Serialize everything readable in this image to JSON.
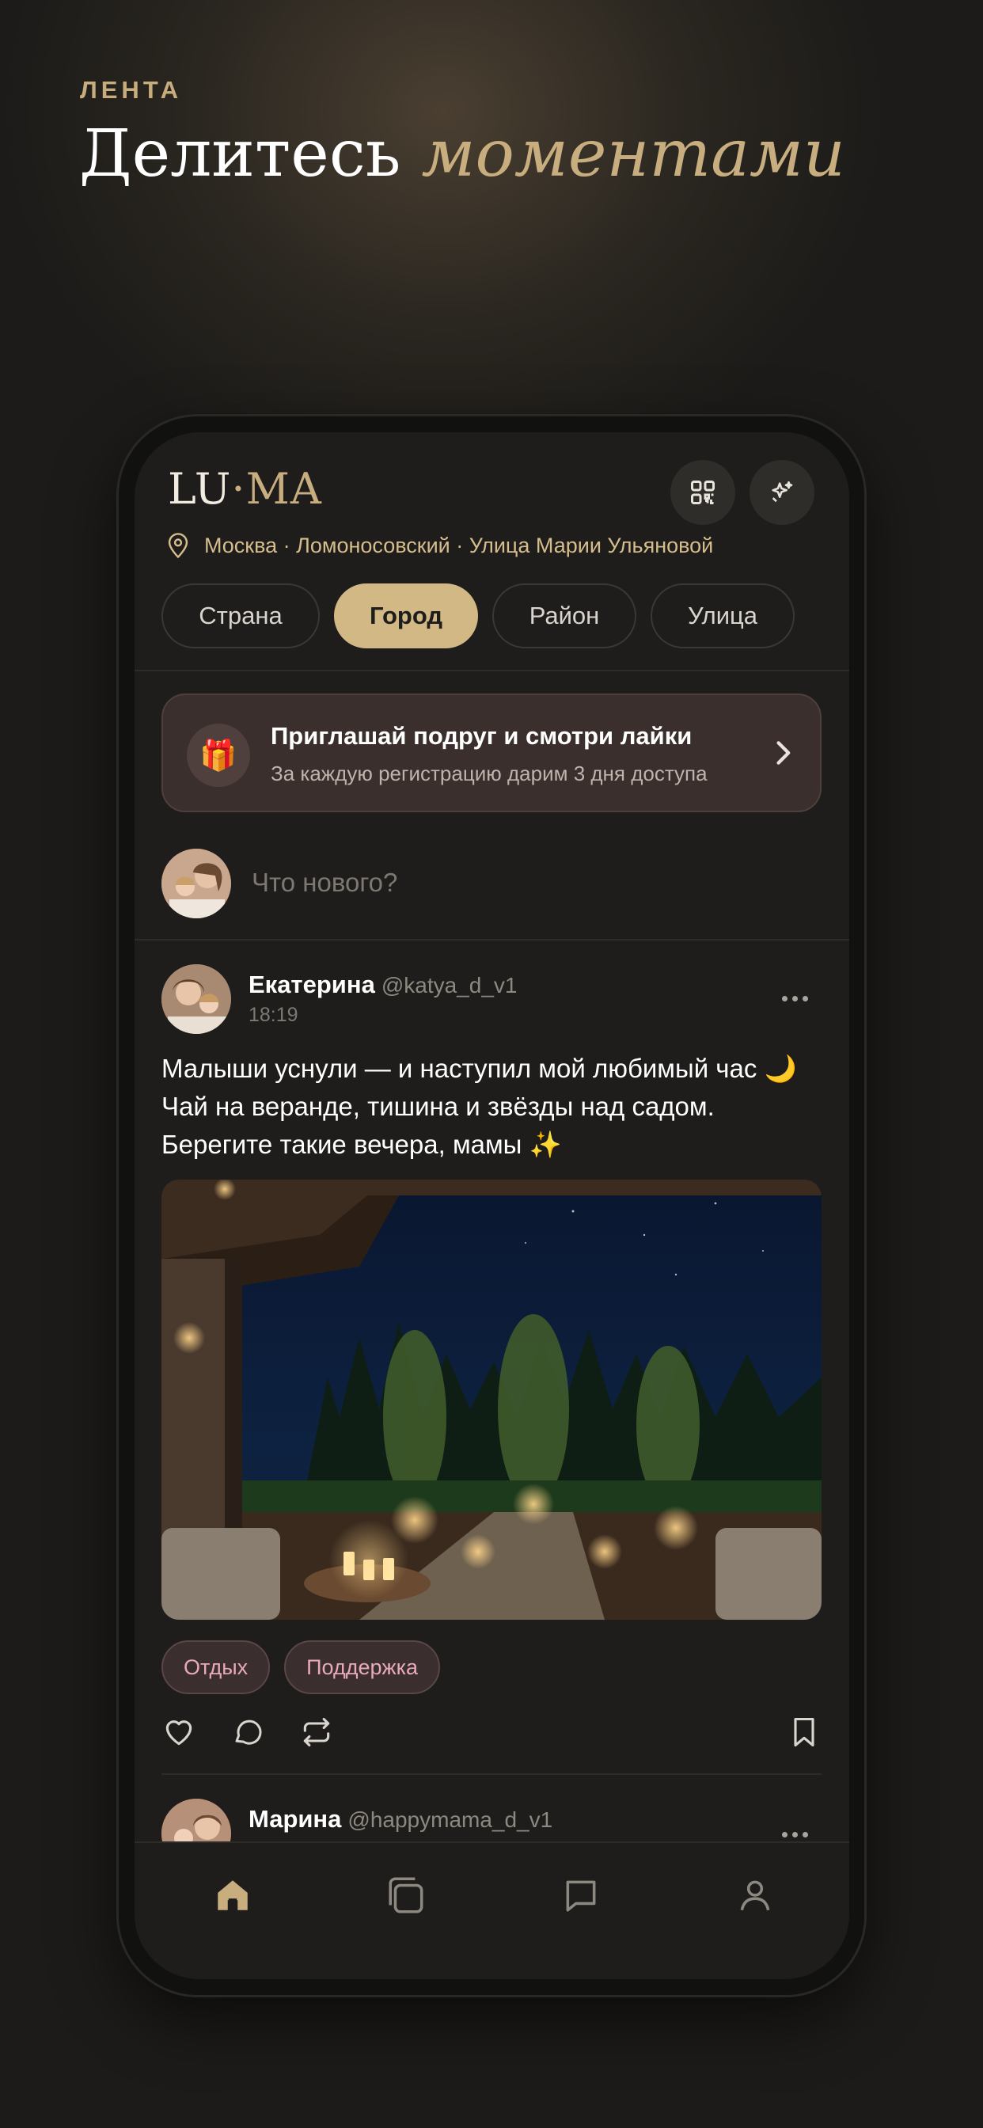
{
  "promo": {
    "eyebrow": "ЛЕНТА",
    "headline_main": "Делитесь",
    "headline_accent": "моментами"
  },
  "app": {
    "logo_left": "LU",
    "logo_dot": "·",
    "logo_right": "MA",
    "location": "Москва · Ломоносовский · Улица Марии Ульяновой",
    "tabs": [
      "Страна",
      "Город",
      "Район",
      "Улица"
    ],
    "active_tab": "Город"
  },
  "invite": {
    "icon": "gift-icon",
    "title": "Приглашай подруг и смотри лайки",
    "subtitle": "За каждую регистрацию дарим 3 дня доступа"
  },
  "composer": {
    "placeholder": "Что нового?"
  },
  "posts": [
    {
      "name": "Екатерина",
      "handle": "@katya_d_v1",
      "time": "18:19",
      "lines": [
        "Малыши уснули — и наступил мой любимый час 🌙",
        "Чай на веранде, тишина и звёзды над садом.",
        "Берегите такие вечера, мамы ✨"
      ],
      "tags": [
        "Отдых",
        "Поддержка"
      ]
    },
    {
      "name": "Марина",
      "handle": "@happymama_d_v1"
    }
  ],
  "colors": {
    "accent": "#c8ad7f",
    "tab_active": "#d1b885",
    "tag_text": "#e8a9b8"
  },
  "nav": [
    "home-icon",
    "cards-icon",
    "chat-icon",
    "profile-icon"
  ]
}
